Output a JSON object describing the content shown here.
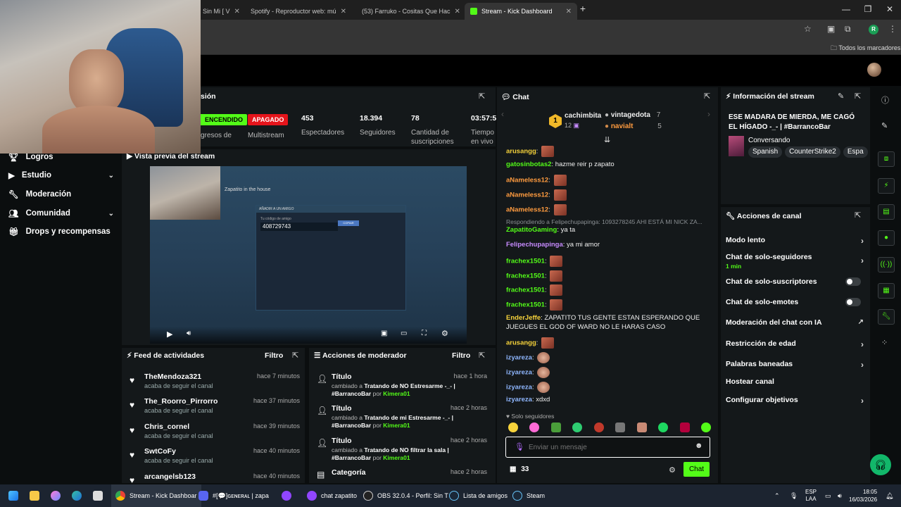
{
  "browser": {
    "tabs": [
      {
        "label": "Sin Mi [ V"
      },
      {
        "label": "Spotify - Reproductor web: mú"
      },
      {
        "label": "(53) Farruko - Cositas Que Hac"
      },
      {
        "label": "Stream - Kick Dashboard"
      }
    ],
    "new_tab": "+",
    "bookmarks_all": "Todos los marcadores",
    "profile_initial": "R"
  },
  "sidenav": {
    "items": [
      {
        "label": "Logros"
      },
      {
        "label": "Estudio"
      },
      {
        "label": "Moderación"
      },
      {
        "label": "Comunidad"
      },
      {
        "label": "Drops y recompensas"
      }
    ]
  },
  "session": {
    "title_fragment": "sión",
    "stats": [
      {
        "value": "ENCENDIDO",
        "label": "gresos de",
        "badge_color": "#53fc18"
      },
      {
        "value": "APAGADO",
        "label": "Multistream",
        "badge_color": "#e5141b"
      },
      {
        "value": "453",
        "label": "Espectadores"
      },
      {
        "value": "18.394",
        "label": "Seguidores"
      },
      {
        "value": "78",
        "label": "Cantidad de suscripciones"
      },
      {
        "value": "03:57:5",
        "label": "Tiempo en vivo"
      }
    ]
  },
  "preview": {
    "title": "Vista previa del stream",
    "inner_title": "Zapatito in the house",
    "code_label": "Tu código de amigo",
    "code": "408729743",
    "copy_btn": "COPIAR",
    "header": "AÑADIR A UN AMIGO"
  },
  "feed": {
    "title": "Feed de actividades",
    "filter": "Filtro",
    "items": [
      {
        "name": "TheMendoza321",
        "sub": "acaba de seguir el canal",
        "time": "hace 7 minutos"
      },
      {
        "name": "The_Roorro_Pirrorro",
        "sub": "acaba de seguir el canal",
        "time": "hace 37 minutos"
      },
      {
        "name": "Chris_cornel",
        "sub": "acaba de seguir el canal",
        "time": "hace 39 minutos"
      },
      {
        "name": "SwtCoFy",
        "sub": "acaba de seguir el canal",
        "time": "hace 40 minutos"
      },
      {
        "name": "arcangelsb123",
        "sub": "",
        "time": "hace 40 minutos"
      }
    ]
  },
  "modactions": {
    "title": "Acciones de moderador",
    "filter": "Filtro",
    "items": [
      {
        "name": "Título",
        "pre": "cambiado a",
        "text": "Tratando de NO Estresarme -_- | #BarrancoBar",
        "por": "por",
        "mod": "Kimera01",
        "time": "hace 1 hora"
      },
      {
        "name": "Título",
        "pre": "cambiado a",
        "text": "Tratando de mi Estresarme -_- | #BarrancoBar",
        "por": "por",
        "mod": "Kimera01",
        "time": "hace 2 horas"
      },
      {
        "name": "Título",
        "pre": "cambiado a",
        "text": "Tratando de NO filtrar la sala | #BarrancoBar",
        "por": "por",
        "mod": "Kimera01",
        "time": "hace 2 horas"
      },
      {
        "name": "Categoría",
        "pre": "",
        "text": "",
        "por": "",
        "mod": "",
        "time": "hace 2 horas"
      }
    ]
  },
  "chat": {
    "title": "Chat",
    "top_rank": "1",
    "top": [
      {
        "name": "cachimbita",
        "count": "12"
      },
      {
        "name": "vintagedota",
        "count": "7"
      },
      {
        "name": "navialt",
        "count": "5"
      }
    ],
    "messages": [
      {
        "user": "arusangg",
        "text": "",
        "color": "#f7d33b",
        "emote": true
      },
      {
        "user": "gatosinbotas2",
        "text": "hazme reir p zapato",
        "color": "#53fc18"
      },
      {
        "user": "aNameless12",
        "text": "",
        "color": "#ff9b3f",
        "emote": true
      },
      {
        "user": "aNameless12",
        "text": "",
        "color": "#ff9b3f",
        "emote": true
      },
      {
        "user": "aNameless12",
        "text": "",
        "color": "#ff9b3f",
        "emote": true
      },
      {
        "user": "ZapatitoGaming",
        "text": "ya ta",
        "color": "#53fc18",
        "reply": "Respondiendo a Felipechupapinga: 1093278245 AHI ESTÁ MI NICK ZA..."
      },
      {
        "user": "Felipechupapinga",
        "text": "ya mi amor",
        "color": "#c78bff"
      },
      {
        "user": "frachex1501",
        "text": "",
        "color": "#53fc18",
        "emote": true
      },
      {
        "user": "frachex1501",
        "text": "",
        "color": "#53fc18",
        "emote": true
      },
      {
        "user": "frachex1501",
        "text": "",
        "color": "#53fc18",
        "emote": true
      },
      {
        "user": "frachex1501",
        "text": "",
        "color": "#53fc18",
        "emote": true
      },
      {
        "user": "EnderJeffe",
        "text": "ZAPATITO TUS GENTE ESTAN ESPERANDO QUE",
        "text2": "JUEGUES EL GOD OF WARD NO LE HARAS CASO",
        "color": "#f7d33b"
      },
      {
        "user": "arusangg",
        "text": "",
        "color": "#f7d33b",
        "emote": true
      },
      {
        "user": "izyareza",
        "text": "",
        "color": "#8fb7ff",
        "emote": "round"
      },
      {
        "user": "izyareza",
        "text": "",
        "color": "#8fb7ff",
        "emote": "round"
      },
      {
        "user": "izyareza",
        "text": "",
        "color": "#8fb7ff",
        "emote": "round"
      },
      {
        "user": "izyareza",
        "text": "xdxd",
        "color": "#8fb7ff"
      }
    ],
    "followers_only": "Solo seguidores",
    "placeholder": "Enviar un mensaje",
    "points": "33",
    "send": "Chat"
  },
  "streaminfo": {
    "title": "Información del stream",
    "stream_title": "ESE MADARA DE MIERDA, ME CAGÓ EL HÍGADO -_- | #BarrancoBar",
    "category": "Conversando",
    "tags": [
      "Spanish",
      "CounterStrike2",
      "Espa"
    ]
  },
  "channel_actions": {
    "title": "Acciones de canal",
    "items": [
      {
        "label": "Modo lento",
        "kind": "chev"
      },
      {
        "label": "Chat de solo-seguidores",
        "sub": "1 min",
        "kind": "chev"
      },
      {
        "label": "Chat de solo-suscriptores",
        "kind": "toggle"
      },
      {
        "label": "Chat de solo-emotes",
        "kind": "toggle"
      },
      {
        "label": "Moderación del chat con IA",
        "kind": "ext"
      },
      {
        "label": "Restricción de edad",
        "kind": "chev"
      },
      {
        "label": "Palabras baneadas",
        "kind": "chev"
      },
      {
        "label": "Hostear canal",
        "kind": "none"
      },
      {
        "label": "Configurar objetivos",
        "kind": "chev"
      }
    ]
  },
  "taskbar": {
    "apps": [
      {
        "label": "Stream - Kick Dashboar"
      },
      {
        "label": "#[💬]ɢᴇɴᴇʀᴀʟ | zapa"
      },
      {
        "label": "chat zapatito"
      },
      {
        "label": "OBS 32.0.4 - Perfil: Sin T"
      },
      {
        "label": "Lista de amigos"
      },
      {
        "label": "Steam"
      }
    ],
    "lang": "ESP",
    "lang2": "LAA",
    "time": "18:05",
    "date": "16/03/2026"
  },
  "colors": {
    "accent": "#53fc18",
    "danger": "#e5141b",
    "panel": "#14181a"
  }
}
